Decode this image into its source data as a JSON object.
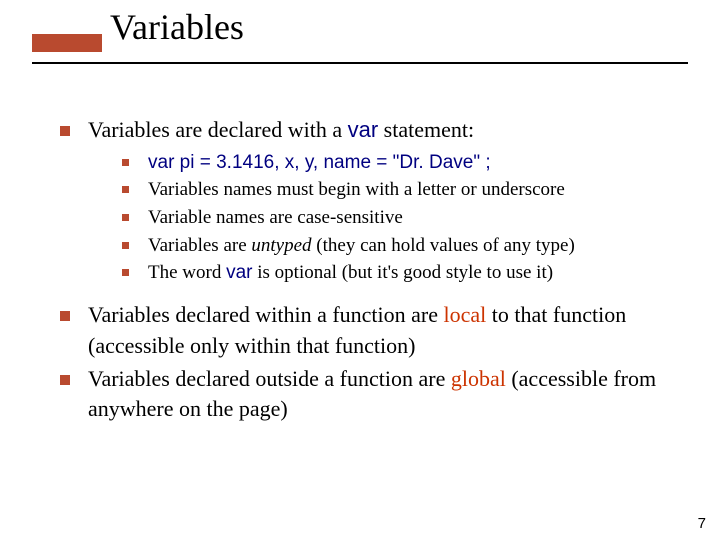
{
  "title": "Variables",
  "bullet1_pre": "Variables are declared with a ",
  "bullet1_code": "var",
  "bullet1_post": " statement:",
  "sub1_code": "var pi = 3.1416, x, y, name = \"Dr. Dave\" ;",
  "sub2": "Variables names must begin with a letter or underscore",
  "sub3": " Variable names are case-sensitive",
  "sub4_pre": "Variables are ",
  "sub4_em": "untyped",
  "sub4_post": " (they can hold values of any type)",
  "sub5_pre": "The word ",
  "sub5_code": "var",
  "sub5_post": " is optional (but it's good style to use it)",
  "bullet2_pre": "Variables declared within a function are ",
  "bullet2_red": "local",
  "bullet2_post": " to that function (accessible only within that function)",
  "bullet3_pre": "Variables declared outside a function are ",
  "bullet3_red": "global",
  "bullet3_post": " (accessible from anywhere on the page)",
  "page_number": "7"
}
